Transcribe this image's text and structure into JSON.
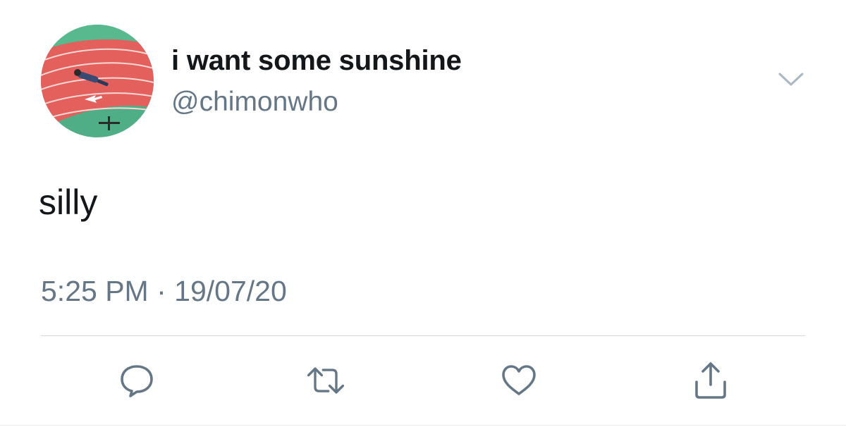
{
  "user": {
    "display_name": "i want some sunshine",
    "handle": "@chimonwho",
    "avatar_icon": "avatar-running-track-photo"
  },
  "tweet": {
    "text": "silly",
    "time": "5:25 PM",
    "separator": "·",
    "date": "19/07/20"
  },
  "actions": {
    "reply_icon": "speech-bubble-icon",
    "retweet_icon": "retweet-arrows-icon",
    "like_icon": "heart-icon",
    "share_icon": "share-upload-icon"
  },
  "colors": {
    "primary_text": "#14171a",
    "secondary_text": "#657786",
    "icon": "#657786",
    "divider": "#d6dadd"
  }
}
